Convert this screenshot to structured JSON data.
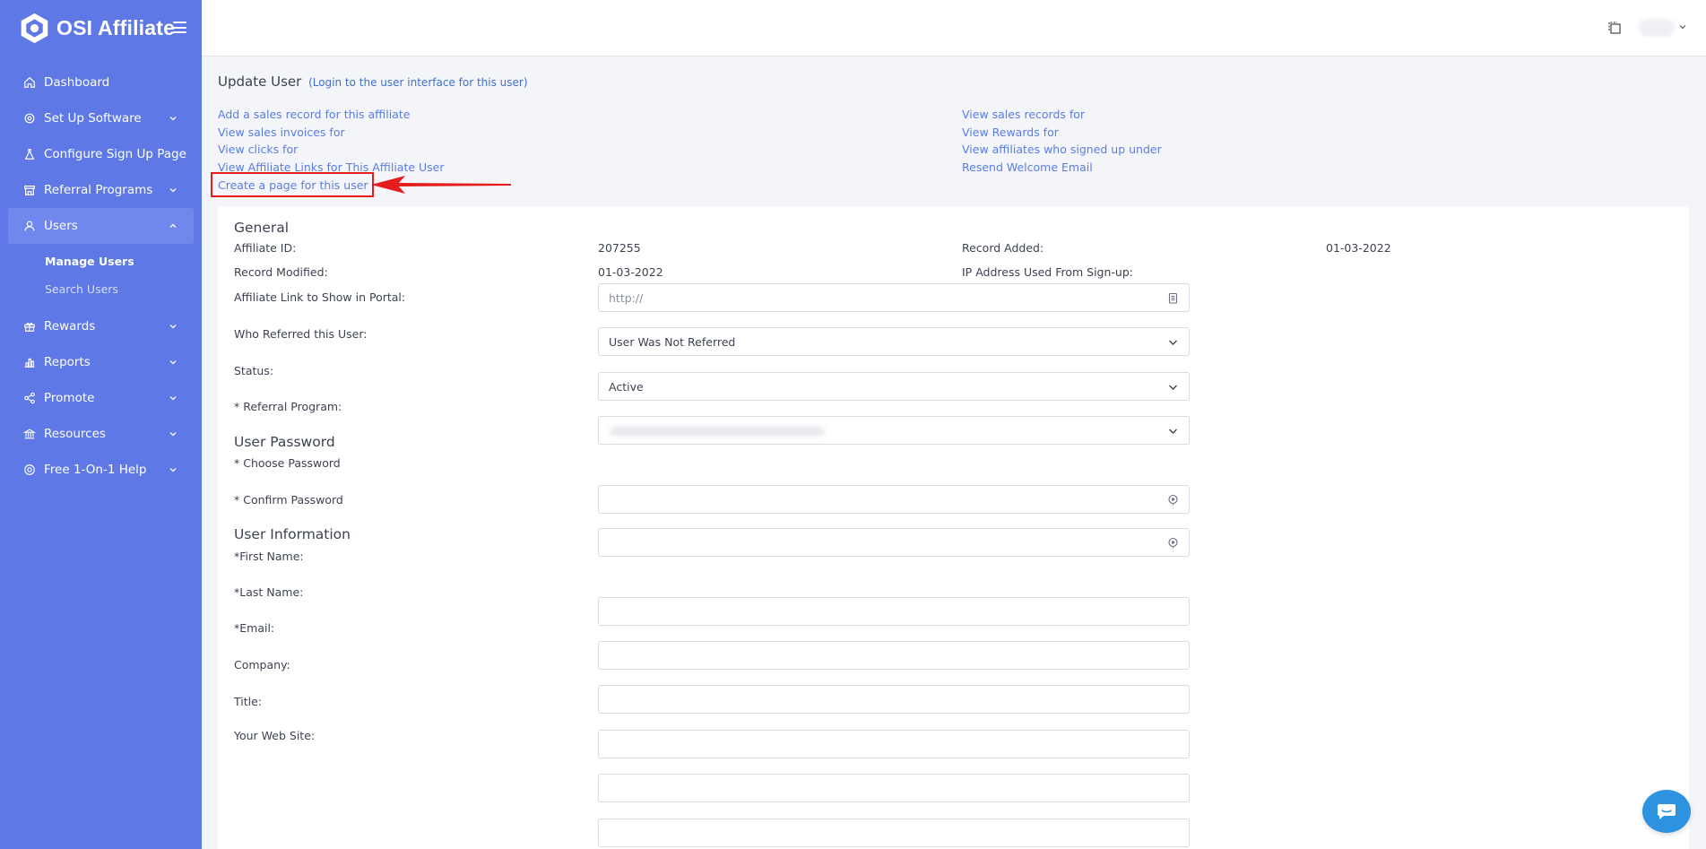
{
  "brand": {
    "name": "OSI Affiliate"
  },
  "sidebar": {
    "items": [
      {
        "label": "Dashboard",
        "icon": "home-icon",
        "has_chevron": false
      },
      {
        "label": "Set Up Software",
        "icon": "gear-icon",
        "has_chevron": true
      },
      {
        "label": "Configure Sign Up Page",
        "icon": "flask-icon",
        "has_chevron": false
      },
      {
        "label": "Referral Programs",
        "icon": "store-icon",
        "has_chevron": true
      },
      {
        "label": "Users",
        "icon": "user-icon",
        "has_chevron": true,
        "active": true
      },
      {
        "label": "Rewards",
        "icon": "gift-icon",
        "has_chevron": true
      },
      {
        "label": "Reports",
        "icon": "bar-chart-icon",
        "has_chevron": true
      },
      {
        "label": "Promote",
        "icon": "share-icon",
        "has_chevron": true
      },
      {
        "label": "Resources",
        "icon": "bank-icon",
        "has_chevron": true
      },
      {
        "label": "Free 1-On-1 Help",
        "icon": "support-icon",
        "has_chevron": true
      }
    ],
    "users_subitems": [
      {
        "label": "Manage Users",
        "current": true
      },
      {
        "label": "Search Users",
        "current": false
      }
    ]
  },
  "topbar": {
    "icons": [
      "copy-icon",
      "avatar",
      "chevron-down-icon"
    ]
  },
  "page": {
    "title": "Update User",
    "login_link": "(Login to the user interface for this user)",
    "links_left": [
      "Add a sales record for this affiliate",
      "View sales invoices for",
      "View clicks for",
      "View Affiliate Links for This Affiliate User",
      "Create a page for this user"
    ],
    "links_right": [
      "View sales records for",
      "View Rewards for",
      "View affiliates who signed up under",
      "Resend Welcome Email"
    ]
  },
  "general": {
    "title": "General",
    "affiliate_id_label": "Affiliate ID:",
    "affiliate_id_value": "207255",
    "record_added_label": "Record Added:",
    "record_added_value": "01-03-2022",
    "record_modified_label": "Record Modified:",
    "record_modified_value": "01-03-2022",
    "ip_label": "IP Address Used From Sign-up:",
    "ip_value": "",
    "affiliate_link_label": "Affiliate Link to Show in Portal:",
    "affiliate_link_placeholder": "http://",
    "referred_label": "Who Referred this User:",
    "referred_value": "User Was Not Referred",
    "status_label": "Status:",
    "status_value": "Active",
    "program_label": "* Referral Program:"
  },
  "password": {
    "title": "User Password",
    "choose_label": "* Choose Password",
    "confirm_label": "* Confirm Password"
  },
  "user_info": {
    "title": "User Information",
    "first_name_label": "*First Name:",
    "last_name_label": "*Last Name:",
    "email_label": "*Email:",
    "company_label": "Company:",
    "title_label": "Title:",
    "website_label": "Your Web Site:"
  },
  "colors": {
    "sidebar": "#5e78e6",
    "link": "#5b7de2",
    "annotation": "#e51d1d",
    "chat": "#2d93e0"
  }
}
